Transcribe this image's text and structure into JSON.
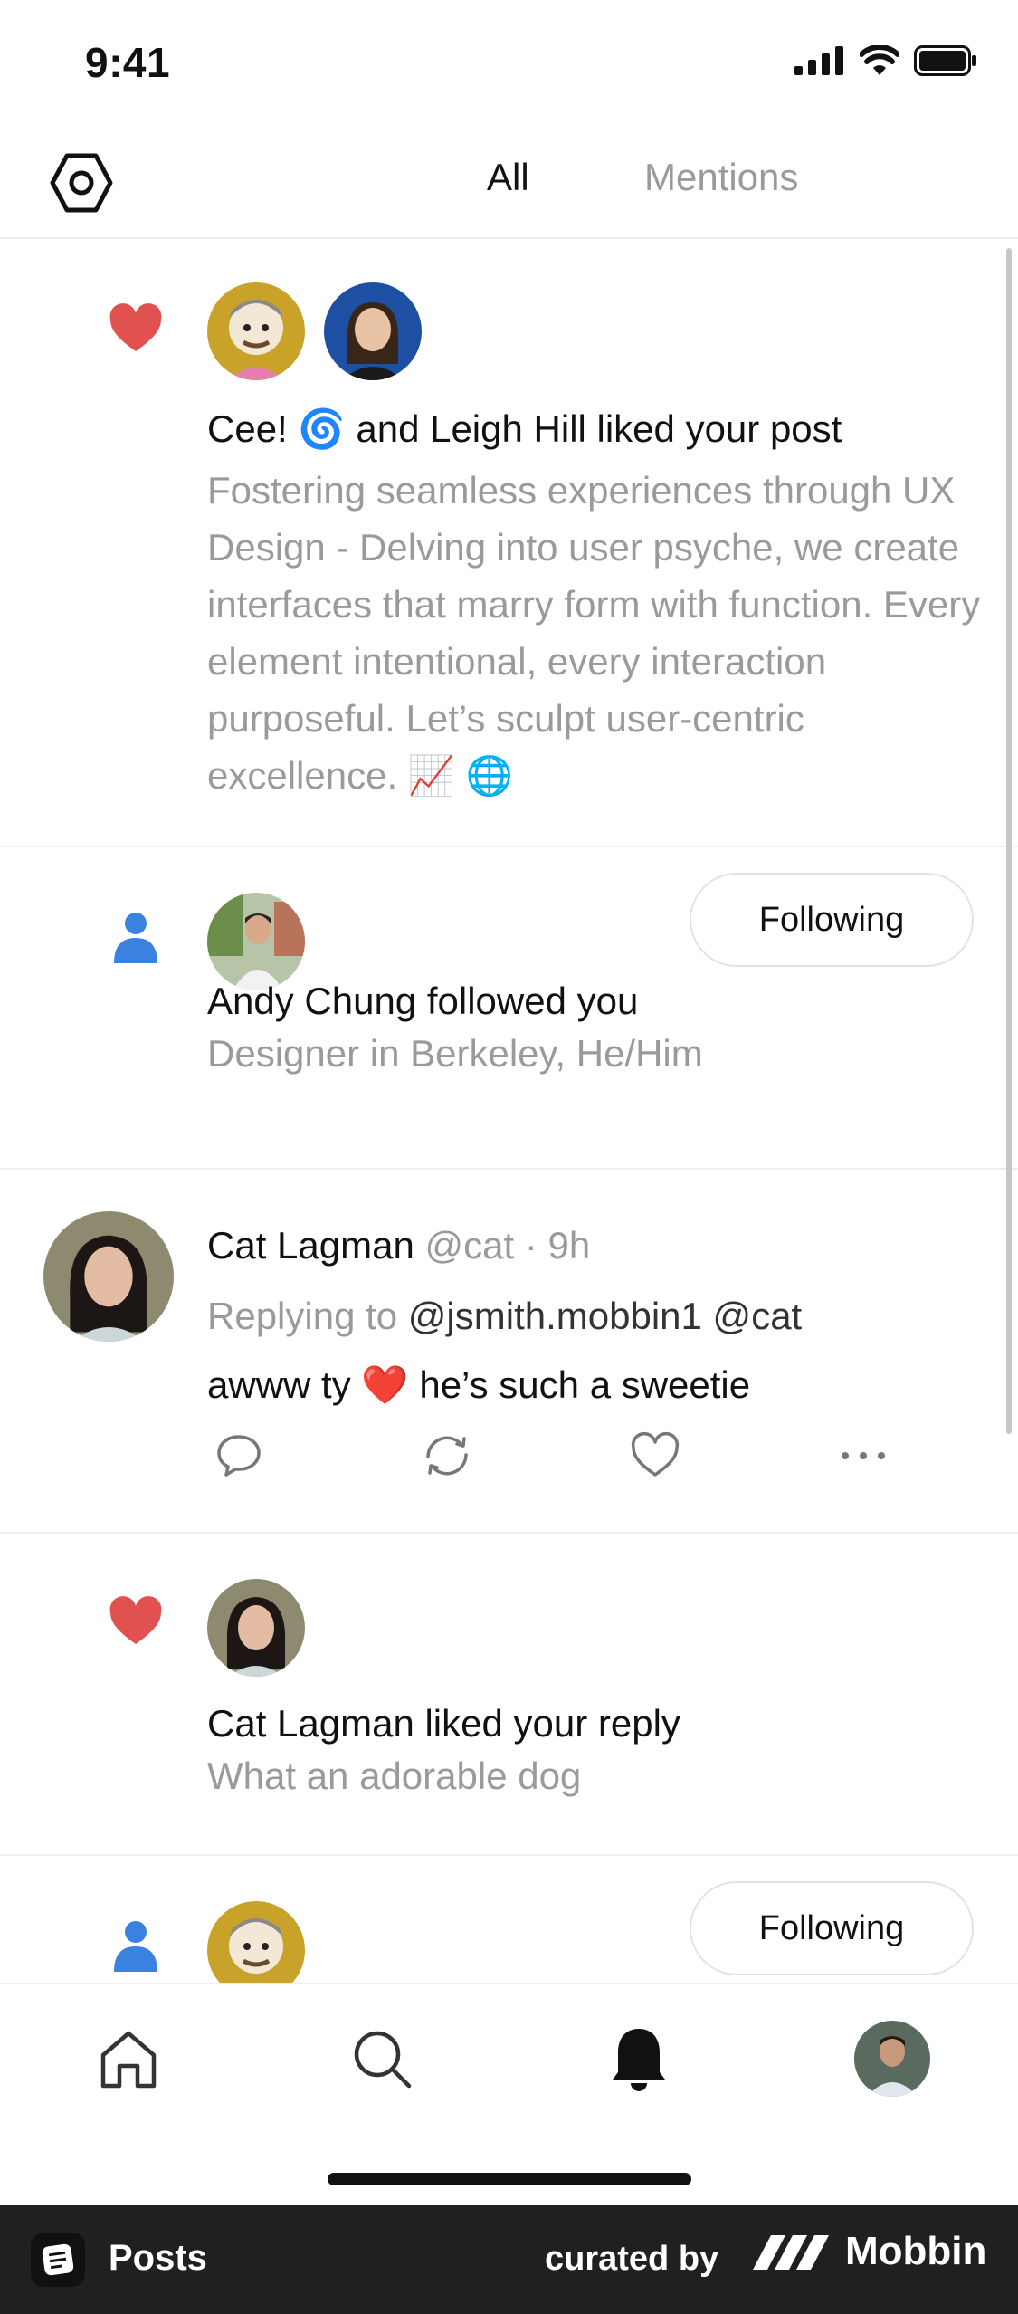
{
  "status_bar": {
    "time": "9:41"
  },
  "top_nav": {
    "settings_icon": "hexagon-settings-icon",
    "tabs": [
      {
        "label": "All",
        "active": true
      },
      {
        "label": "Mentions",
        "active": false
      }
    ]
  },
  "notifications": [
    {
      "type": "like",
      "icon": "heart-icon",
      "headline": "Cee! 🌀 and Leigh Hill liked your post",
      "subtext": "Fostering seamless experiences through UX Design - Delving into user psyche, we create interfaces that marry form with function. Every element intentional, every interaction purposeful. Let’s sculpt user-centric excellence. 📈 🌐"
    },
    {
      "type": "follow",
      "icon": "person-icon",
      "headline": "Andy Chung followed you",
      "subtext": "Designer in Berkeley, He/Him",
      "button_label": "Following"
    },
    {
      "type": "reply",
      "name": "Cat Lagman",
      "handle": "@cat",
      "separator": "·",
      "time": "9h",
      "replying_prefix": "Replying to",
      "replying_to": "@jsmith.mobbin1 @cat",
      "body_pre": "awww ty",
      "body_emoji": "❤️",
      "body_post": "he’s such a sweetie",
      "actions": [
        "comment-icon",
        "repost-icon",
        "like-icon",
        "more-icon"
      ]
    },
    {
      "type": "like",
      "icon": "heart-icon",
      "headline": "Cat Lagman liked your reply",
      "subtext": "What an adorable dog"
    },
    {
      "type": "follow",
      "icon": "person-icon",
      "button_label": "Following"
    }
  ],
  "tab_bar": {
    "items": [
      "home-icon",
      "search-icon",
      "bell-icon",
      "profile-avatar"
    ],
    "active": "bell-icon"
  },
  "banner": {
    "section": "Posts",
    "curated_by": "curated by",
    "brand": "Mobbin"
  },
  "colors": {
    "heart": "#e0514f",
    "person": "#3b82e0",
    "muted_text": "#9a9a9a",
    "divider": "#eeeeee",
    "banner_bg": "#202020"
  }
}
